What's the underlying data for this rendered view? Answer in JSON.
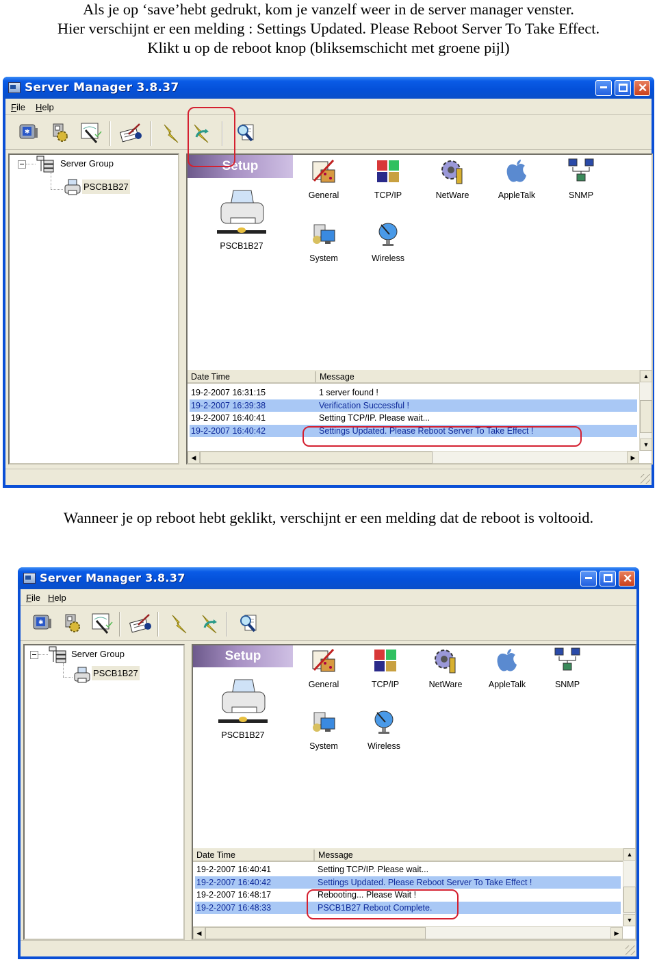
{
  "captions": {
    "intro_lines": [
      "Als je op ‘save’hebt gedrukt, kom je vanzelf weer in de server manager venster.",
      "Hier verschijnt er een melding : Settings Updated. Please Reboot Server To Take Effect.",
      "Klikt u op de reboot knop (bliksemschicht met groene pijl)"
    ],
    "middle": "Wanneer je op reboot hebt geklikt, verschijnt er een melding dat de reboot is voltooid."
  },
  "app": {
    "title": "Server Manager 3.8.37",
    "window_controls": {
      "minimize": "_",
      "maximize": "□",
      "close": "✕"
    },
    "menu": [
      "File",
      "Help"
    ],
    "toolbar": [
      {
        "icon": "monitor-icon",
        "tooltip": "Search"
      },
      {
        "icon": "gear-settings-icon",
        "tooltip": "Settings"
      },
      {
        "icon": "wizard-icon",
        "tooltip": "Wizard"
      },
      {
        "icon": "notepad-pen-icon",
        "tooltip": "Configure"
      },
      {
        "icon": "lightning-icon",
        "tooltip": "Reset"
      },
      {
        "icon": "lightning-reboot-icon",
        "tooltip": "Reboot"
      },
      {
        "icon": "magnifier-document-icon",
        "tooltip": "Find"
      }
    ],
    "tree": {
      "root": "Server Group",
      "child": "PSCB1B27"
    },
    "setup": {
      "banner": "Setup",
      "device_name": "PSCB1B27",
      "items": [
        {
          "label": "General",
          "icon": "general-settings-icon"
        },
        {
          "label": "TCP/IP",
          "icon": "tcpip-icon"
        },
        {
          "label": "NetWare",
          "icon": "netware-icon"
        },
        {
          "label": "AppleTalk",
          "icon": "appletalk-icon"
        },
        {
          "label": "SNMP",
          "icon": "snmp-icon"
        },
        {
          "label": "System",
          "icon": "system-icon"
        },
        {
          "label": "Wireless",
          "icon": "wireless-icon"
        }
      ]
    },
    "log_columns": [
      "Date Time",
      "Message"
    ]
  },
  "screens": [
    {
      "log": [
        {
          "datetime": "19-2-2007 16:31:15",
          "message": "1 server found !",
          "selected": false
        },
        {
          "datetime": "19-2-2007 16:39:38",
          "message": "Verification Successful !",
          "selected": true
        },
        {
          "datetime": "19-2-2007 16:40:41",
          "message": "Setting TCP/IP. Please wait...",
          "selected": false
        },
        {
          "datetime": "19-2-2007 16:40:42",
          "message": "Settings Updated. Please Reboot Server To Take Effect !",
          "selected": true
        }
      ]
    },
    {
      "log": [
        {
          "datetime": "19-2-2007 16:40:41",
          "message": "Setting TCP/IP. Please wait...",
          "selected": false
        },
        {
          "datetime": "19-2-2007 16:40:42",
          "message": "Settings Updated. Please Reboot Server To Take Effect !",
          "selected": true
        },
        {
          "datetime": "19-2-2007 16:48:17",
          "message": "Rebooting... Please Wait !",
          "selected": false
        },
        {
          "datetime": "19-2-2007 16:48:33",
          "message": "PSCB1B27 Reboot Complete.",
          "selected": true
        }
      ]
    }
  ],
  "colors": {
    "titlebar": "#0450d8",
    "selection": "#a9c8f5",
    "annotation": "#d42030"
  }
}
